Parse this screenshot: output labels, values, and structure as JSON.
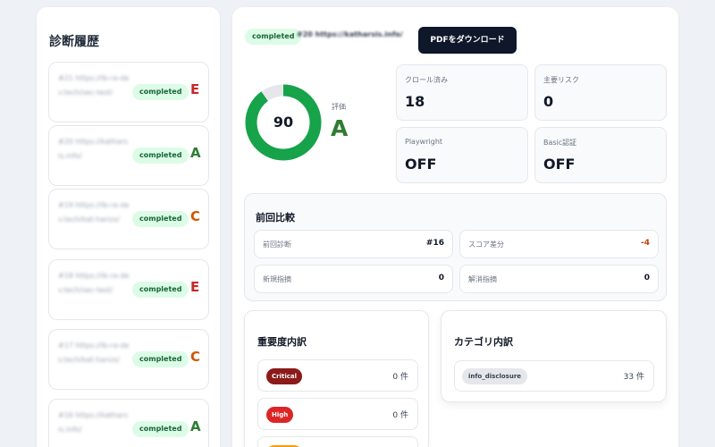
{
  "history": {
    "title": "診断履歴",
    "items": [
      {
        "text": "#21 https://lb-ra-dev.tech/sec-test/",
        "status": "completed",
        "grade": "E",
        "grade_color": "#c62828"
      },
      {
        "text": "#20 https://katharsis.info/",
        "status": "completed",
        "grade": "A",
        "grade_color": "#2e7d32"
      },
      {
        "text": "#19 https://lb-ra-dev.tech/kat-harsis/",
        "status": "completed",
        "grade": "C",
        "grade_color": "#d35400"
      },
      {
        "text": "#18 https://lb-ra-dev.tech/sec-test/",
        "status": "completed",
        "grade": "E",
        "grade_color": "#c62828"
      },
      {
        "text": "#17 https://lb-ra-dev.tech/kat-harsis/",
        "status": "completed",
        "grade": "C",
        "grade_color": "#d35400"
      },
      {
        "text": "#16 https://katharsis.info/",
        "status": "completed",
        "grade": "A",
        "grade_color": "#2e7d32"
      }
    ]
  },
  "detail": {
    "status": "completed",
    "title": "#20 https://katharsis.info/",
    "pdf_label": "PDFをダウンロード",
    "score": 90,
    "score_max": 100,
    "grade_label": "評価",
    "grade": "A",
    "stats": [
      {
        "label": "クロール済み",
        "value": "18"
      },
      {
        "label": "主要リスク",
        "value": "0"
      },
      {
        "label": "Playwright",
        "value": "OFF"
      },
      {
        "label": "Basic認証",
        "value": "OFF"
      }
    ]
  },
  "compare": {
    "title": "前回比較",
    "rows": [
      {
        "label": "前回診断",
        "value": "#16",
        "color": "#111827"
      },
      {
        "label": "スコア差分",
        "value": "-4",
        "color": "#c2410c"
      },
      {
        "label": "新規指摘",
        "value": "0",
        "color": "#111827"
      },
      {
        "label": "解消指摘",
        "value": "0",
        "color": "#111827"
      }
    ]
  },
  "severity": {
    "title": "重要度内訳",
    "rows": [
      {
        "label": "Critical",
        "count": "0 件",
        "color": "#8b1a1a"
      },
      {
        "label": "High",
        "count": "0 件",
        "color": "#dc2626"
      },
      {
        "label": "",
        "count": "",
        "color": "#f59e0b"
      }
    ]
  },
  "category": {
    "title": "カテゴリ内訳",
    "rows": [
      {
        "label": "info_disclosure",
        "count": "33 件"
      }
    ]
  },
  "colors": {
    "score_ring": "#16a34a",
    "score_track": "#e5e7eb",
    "completed_bg": "#dcfce7"
  }
}
